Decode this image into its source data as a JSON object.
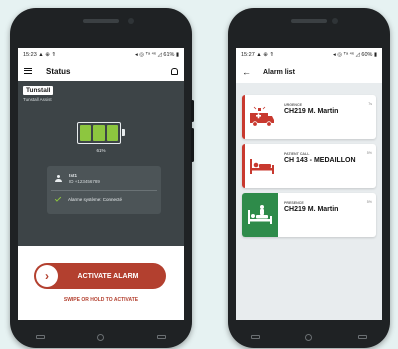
{
  "left_phone": {
    "status_bar": {
      "time": "15:23 ▲ ⊕ ⇑",
      "icons": "◂ ◎ ᵀᵃ ⁴⁶ ◿ 61% ▮"
    },
    "topbar": {
      "title": "Status",
      "menu_icon": "menu-icon",
      "bell_icon": "bell-icon"
    },
    "brand": {
      "logo": "Tunstall",
      "subtitle": "Tunstall Assist"
    },
    "battery": {
      "level_percent": 61,
      "label": "61%",
      "bars": 3,
      "color": "#8dc63f"
    },
    "user": {
      "name": "tst1",
      "id": "ID +123456789"
    },
    "system_status": "Alarme système: Connecté",
    "alarm_button": {
      "label": "ACTIVATE ALARM",
      "knob_glyph": "›",
      "color": "#b3402f"
    },
    "swipe_hint": "SWIPE OR HOLD TO ACTIVATE"
  },
  "right_phone": {
    "status_bar": {
      "time": "15:27 ▲ ⊕ ⇑",
      "icons": "◂ ◎ ᵀᵃ ⁴⁶ ◿ 60% ▮"
    },
    "topbar": {
      "title": "Alarm list",
      "back_glyph": "←"
    },
    "alarms": [
      {
        "type": "URGENCE",
        "room": "CH219 M. Martin",
        "time": "7s",
        "color": "#c8392f",
        "icon": "ambulance-icon"
      },
      {
        "type": "PATIENT CALL",
        "room": "CH 143 - MEDAILLON",
        "time": "5%",
        "color": "#c8392f",
        "icon": "patient-bed-icon"
      },
      {
        "type": "PRESENCE",
        "room": "CH219 M. Martin",
        "time": "5%",
        "color": "#2e8b4a",
        "icon": "caregiver-bed-icon"
      }
    ]
  }
}
